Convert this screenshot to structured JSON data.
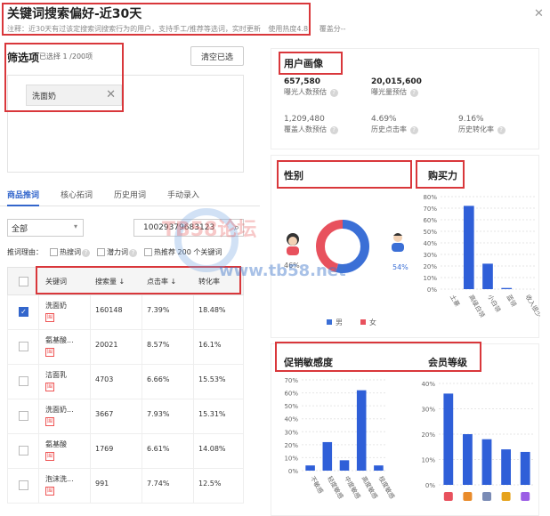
{
  "header": {
    "title": "关键词搜索偏好-近30天",
    "note": "注释：近30天有过该定搜索词搜索行为的用户，支持手工/推荐等选词，实时更新",
    "note2": "使用热度4.8",
    "note3": "覆盖分--",
    "close_icon": "close-icon"
  },
  "filter": {
    "title": "筛选项",
    "count": "已选择 1 /200项",
    "clear_label": "清空已选",
    "chips": [
      {
        "label": "洗面奶"
      }
    ]
  },
  "tabs": [
    {
      "label": "商品推词",
      "active": true
    },
    {
      "label": "核心拓词",
      "active": false
    },
    {
      "label": "历史用词",
      "active": false
    },
    {
      "label": "手动录入",
      "active": false
    }
  ],
  "controls": {
    "select_value": "全部",
    "search_value": "10029379683123"
  },
  "reason": {
    "label": "推词理由：",
    "options": [
      "热搜词",
      "潜力词",
      "热推荐 200 个关键词"
    ]
  },
  "table": {
    "headers": [
      "关键词",
      "搜索量",
      "点击率",
      "转化率"
    ],
    "rows": [
      {
        "kw": "洗面奶",
        "search": "160148",
        "ctr": "7.39%",
        "cvr": "18.48%",
        "checked": true
      },
      {
        "kw": "氨基酸...",
        "search": "20021",
        "ctr": "8.57%",
        "cvr": "16.1%",
        "checked": false
      },
      {
        "kw": "洁面乳",
        "search": "4703",
        "ctr": "6.66%",
        "cvr": "15.53%",
        "checked": false
      },
      {
        "kw": "洗面奶...",
        "search": "3667",
        "ctr": "7.93%",
        "cvr": "15.31%",
        "checked": false
      },
      {
        "kw": "氨基酸",
        "search": "1769",
        "ctr": "6.61%",
        "cvr": "14.08%",
        "checked": false
      },
      {
        "kw": "泡沫洗...",
        "search": "991",
        "ctr": "7.74%",
        "cvr": "12.5%",
        "checked": false
      }
    ],
    "tag": "围"
  },
  "user_profile": {
    "title": "用户画像",
    "stats": [
      {
        "value": "657,580",
        "label": "曝光人数预估"
      },
      {
        "value": "20,015,600",
        "label": "曝光量预估"
      },
      {
        "value": "1,209,480",
        "label": "覆盖人数预估"
      },
      {
        "value": "4.69%",
        "label": "历史点击率"
      },
      {
        "value": "9.16%",
        "label": "历史转化率"
      }
    ]
  },
  "gender": {
    "title": "性别",
    "female_pct": "46%",
    "male_pct": "54%",
    "legend_male": "男",
    "legend_female": "女",
    "male_color": "#3b6fd6",
    "female_color": "#e8515d"
  },
  "purchase_power": {
    "title": "购买力"
  },
  "promo": {
    "title": "促销敏感度"
  },
  "member": {
    "title": "会员等级"
  },
  "watermark": {
    "text1": "TB58论坛",
    "text2": "www.tb58.net"
  },
  "chart_data": [
    {
      "type": "bar",
      "title": "购买力",
      "categories": [
        "土豪",
        "高级白领",
        "小白领",
        "蓝领",
        "收入很少"
      ],
      "values": [
        0,
        72,
        22,
        1,
        0
      ],
      "ylim": [
        0,
        80
      ],
      "yticks": [
        "0%",
        "10%",
        "20%",
        "30%",
        "40%",
        "50%",
        "60%",
        "70%",
        "80%"
      ]
    },
    {
      "type": "bar",
      "title": "促销敏感度",
      "categories": [
        "不敏感",
        "轻度敏感",
        "中度敏感",
        "高度敏感",
        "极度敏感"
      ],
      "values": [
        4,
        22,
        8,
        62,
        4
      ],
      "ylim": [
        0,
        70
      ],
      "yticks": [
        "0%",
        "10%",
        "20%",
        "30%",
        "40%",
        "50%",
        "60%",
        "70%"
      ]
    },
    {
      "type": "bar",
      "title": "会员等级",
      "categories": [
        "1",
        "2",
        "3",
        "4",
        "5"
      ],
      "values": [
        36,
        20,
        18,
        14,
        13
      ],
      "ylim": [
        0,
        40
      ],
      "yticks": [
        "0%",
        "10%",
        "20%",
        "30%",
        "40%"
      ]
    }
  ]
}
